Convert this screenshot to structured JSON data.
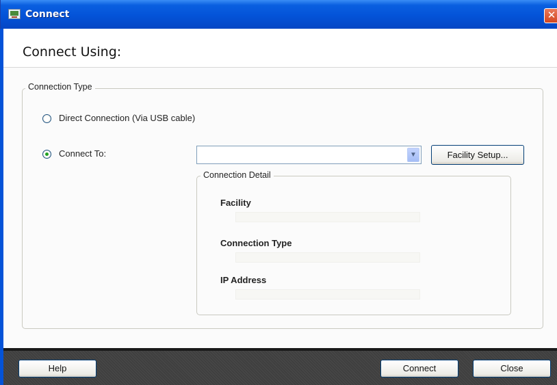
{
  "window": {
    "title": "Connect",
    "close_glyph": "✕",
    "icon": "connect-app-icon"
  },
  "header": {
    "title": "Connect Using:"
  },
  "connection_type": {
    "group_label": "Connection Type",
    "options": [
      {
        "label": "Direct Connection (Via USB cable)",
        "selected": false
      },
      {
        "label": "Connect To:",
        "selected": true
      }
    ],
    "connect_to_value": "",
    "dropdown_icon": "chevron-down-icon",
    "facility_setup_label": "Facility Setup..."
  },
  "connection_detail": {
    "group_label": "Connection Detail",
    "fields": [
      {
        "label": "Facility",
        "value": ""
      },
      {
        "label": "Connection Type",
        "value": ""
      },
      {
        "label": "IP Address",
        "value": ""
      }
    ]
  },
  "footer": {
    "help_label": "Help",
    "connect_label": "Connect",
    "close_label": "Close"
  },
  "colors": {
    "titlebar": "#0453d8",
    "radio_selected_dot": "#21a121",
    "footer_bg": "#3f3f3f"
  }
}
